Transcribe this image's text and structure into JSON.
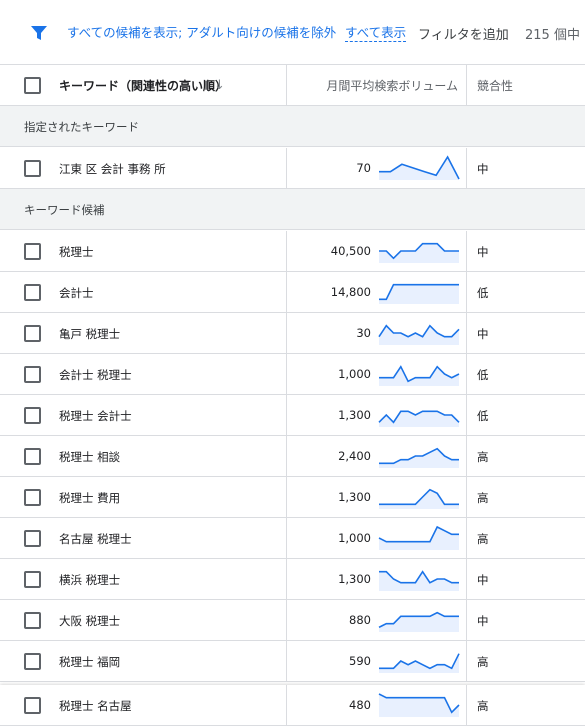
{
  "filter_bar": {
    "filter_text": "すべての候補を表示; アダルト向けの候補を除外",
    "show_all": "すべて表示",
    "add_filter": "フィルタを追加",
    "count": "215 個中"
  },
  "table_header": {
    "keyword": "キーワード（関連性の高い順）",
    "volume": "月間平均検索ボリューム",
    "competition": "競合性"
  },
  "sections": {
    "specified": "指定されたキーワード",
    "suggested": "キーワード候補"
  },
  "colors": {
    "accent": "#1a73e8",
    "spark_fill": "#e8f0fe"
  },
  "specified_rows": [
    {
      "keyword": "江東 区 会計 事務 所",
      "volume": "70",
      "competition": "中",
      "trend": [
        2,
        2,
        4,
        3,
        2,
        1,
        6,
        0
      ]
    }
  ],
  "rows": [
    {
      "keyword": "税理士",
      "volume": "40,500",
      "competition": "中",
      "trend": [
        3,
        3,
        1,
        3,
        3,
        3,
        5,
        5,
        5,
        3,
        3,
        3
      ]
    },
    {
      "keyword": "会計士",
      "volume": "14,800",
      "competition": "低",
      "trend": [
        1,
        1,
        5,
        5,
        5,
        5,
        5,
        5,
        5,
        5,
        5,
        5
      ]
    },
    {
      "keyword": "亀戸 税理士",
      "volume": "30",
      "competition": "中",
      "trend": [
        2,
        5,
        3,
        3,
        2,
        3,
        2,
        5,
        3,
        2,
        2,
        4
      ]
    },
    {
      "keyword": "会計士 税理士",
      "volume": "1,000",
      "competition": "低",
      "trend": [
        2,
        2,
        2,
        5,
        1,
        2,
        2,
        2,
        5,
        3,
        2,
        3
      ]
    },
    {
      "keyword": "税理士 会計士",
      "volume": "1,300",
      "competition": "低",
      "trend": [
        1,
        3,
        1,
        4,
        4,
        3,
        4,
        4,
        4,
        3,
        3,
        1
      ]
    },
    {
      "keyword": "税理士 相談",
      "volume": "2,400",
      "competition": "高",
      "trend": [
        1,
        1,
        1,
        2,
        2,
        3,
        3,
        4,
        5,
        3,
        2,
        2
      ]
    },
    {
      "keyword": "税理士 費用",
      "volume": "1,300",
      "competition": "高",
      "trend": [
        1,
        1,
        1,
        1,
        1,
        1,
        3,
        5,
        4,
        1,
        1,
        1
      ]
    },
    {
      "keyword": "名古屋 税理士",
      "volume": "1,000",
      "competition": "高",
      "trend": [
        3,
        2,
        2,
        2,
        2,
        2,
        2,
        2,
        6,
        5,
        4,
        4
      ]
    },
    {
      "keyword": "横浜 税理士",
      "volume": "1,300",
      "competition": "中",
      "trend": [
        5,
        5,
        3,
        2,
        2,
        2,
        5,
        2,
        3,
        3,
        2,
        2
      ]
    },
    {
      "keyword": "大阪 税理士",
      "volume": "880",
      "competition": "中",
      "trend": [
        1,
        2,
        2,
        4,
        4,
        4,
        4,
        4,
        5,
        4,
        4,
        4
      ]
    },
    {
      "keyword": "税理士 福岡",
      "volume": "590",
      "competition": "高",
      "trend": [
        1,
        1,
        1,
        3,
        2,
        3,
        2,
        1,
        2,
        2,
        1,
        5
      ]
    },
    {
      "keyword": "税理士 名古屋",
      "volume": "480",
      "competition": "高",
      "trend": [
        6,
        5,
        5,
        5,
        5,
        5,
        5,
        5,
        5,
        5,
        1,
        3
      ]
    }
  ]
}
